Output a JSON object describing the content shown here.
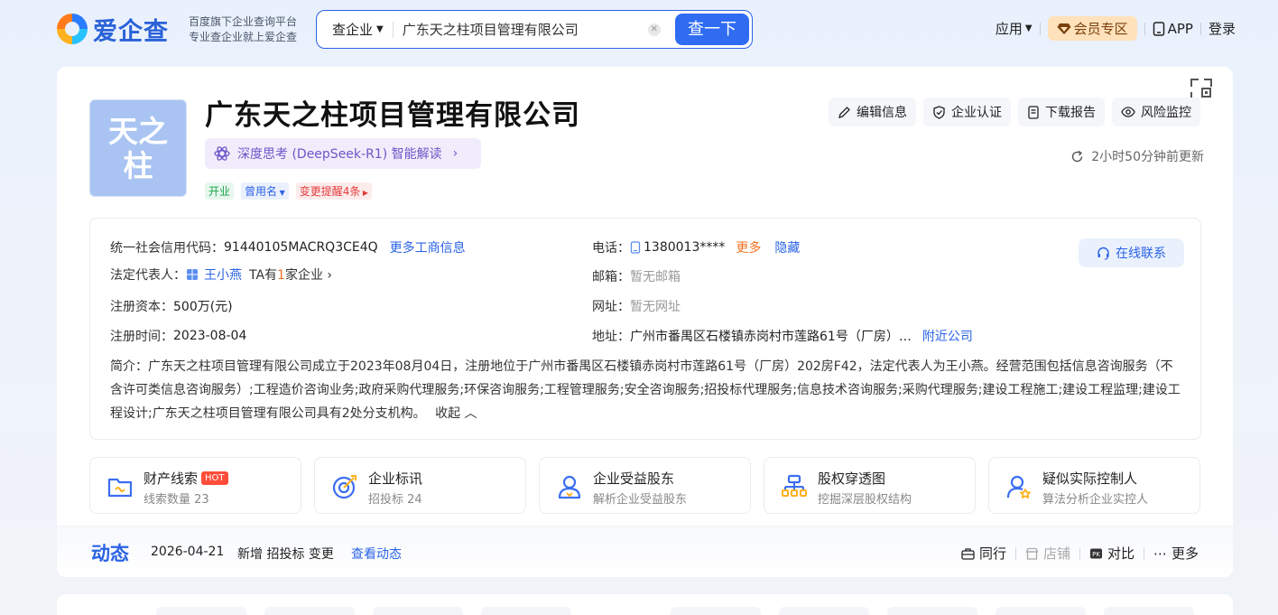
{
  "header": {
    "logo_text": "爱企查",
    "logo_sub1": "百度旗下企业查询平台",
    "logo_sub2": "专业查企业就上爱企查",
    "search_type": "查企业",
    "search_value": "广东天之柱项目管理有限公司",
    "search_button": "查一下",
    "nav_apps": "应用",
    "nav_vip": "会员专区",
    "nav_app": "APP",
    "nav_login": "登录"
  },
  "company": {
    "logo_text_1": "天之",
    "logo_text_2": "柱",
    "name": "广东天之柱项目管理有限公司",
    "ai_pill": "深度思考 (DeepSeek-R1) 智能解读",
    "tags": [
      "开业",
      "曾用名",
      "变更提醒4条"
    ],
    "updated": "2小时50分钟前更新"
  },
  "actions": {
    "edit": "编辑信息",
    "certify": "企业认证",
    "download": "下载报告",
    "monitor": "风险监控"
  },
  "info": {
    "credit_code_label": "统一社会信用代码：",
    "credit_code": "91440105MACRQ3CE4Q",
    "more_business": "更多工商信息",
    "legal_rep_label": "法定代表人：",
    "legal_rep": "王小燕",
    "legal_rep_suffix_1": "TA有",
    "legal_rep_count": "1",
    "legal_rep_suffix_2": "家企业",
    "capital_label": "注册资本：",
    "capital": "500万(元)",
    "reg_date_label": "注册时间：",
    "reg_date": "2023-08-04",
    "phone_label": "电话：",
    "phone": "1380013****",
    "phone_more": "更多",
    "phone_hide": "隐藏",
    "email_label": "邮箱：",
    "email": "暂无邮箱",
    "website_label": "网址：",
    "website": "暂无网址",
    "address_label": "地址：",
    "address": "广州市番禺区石楼镇赤岗村市莲路61号（厂房）…",
    "nearby": "附近公司",
    "contact_button": "在线联系",
    "intro_label": "简介：",
    "intro": "广东天之柱项目管理有限公司成立于2023年08月04日，注册地位于广州市番禺区石楼镇赤岗村市莲路61号（厂房）202房F42，法定代表人为王小燕。经营范围包括信息咨询服务（不含许可类信息咨询服务）;工程造价咨询业务;政府采购代理服务;环保咨询服务;工程管理服务;安全咨询服务;招投标代理服务;信息技术咨询服务;采购代理服务;建设工程施工;建设工程监理;建设工程设计;广东天之柱项目管理有限公司具有2处分支机构。",
    "collapse": "收起"
  },
  "features": [
    {
      "title": "财产线索",
      "badge": "HOT",
      "sub": "线索数量 23"
    },
    {
      "title": "企业标讯",
      "badge": "",
      "sub": "招投标 24"
    },
    {
      "title": "企业受益股东",
      "badge": "",
      "sub": "解析企业受益股东"
    },
    {
      "title": "股权穿透图",
      "badge": "",
      "sub": "挖掘深层股权结构"
    },
    {
      "title": "疑似实际控制人",
      "badge": "",
      "sub": "算法分析企业实控人"
    }
  ],
  "dynamics": {
    "title": "动态",
    "date": "2026-04-21",
    "text": "新增 招投标 变更",
    "link": "查看动态",
    "peer": "同行",
    "shop": "店铺",
    "compare": "对比",
    "more": "更多"
  },
  "colors": {
    "brand": "#2a63e5",
    "vip_bg": "#ffe2bb",
    "hot": "#ff4d3a"
  }
}
